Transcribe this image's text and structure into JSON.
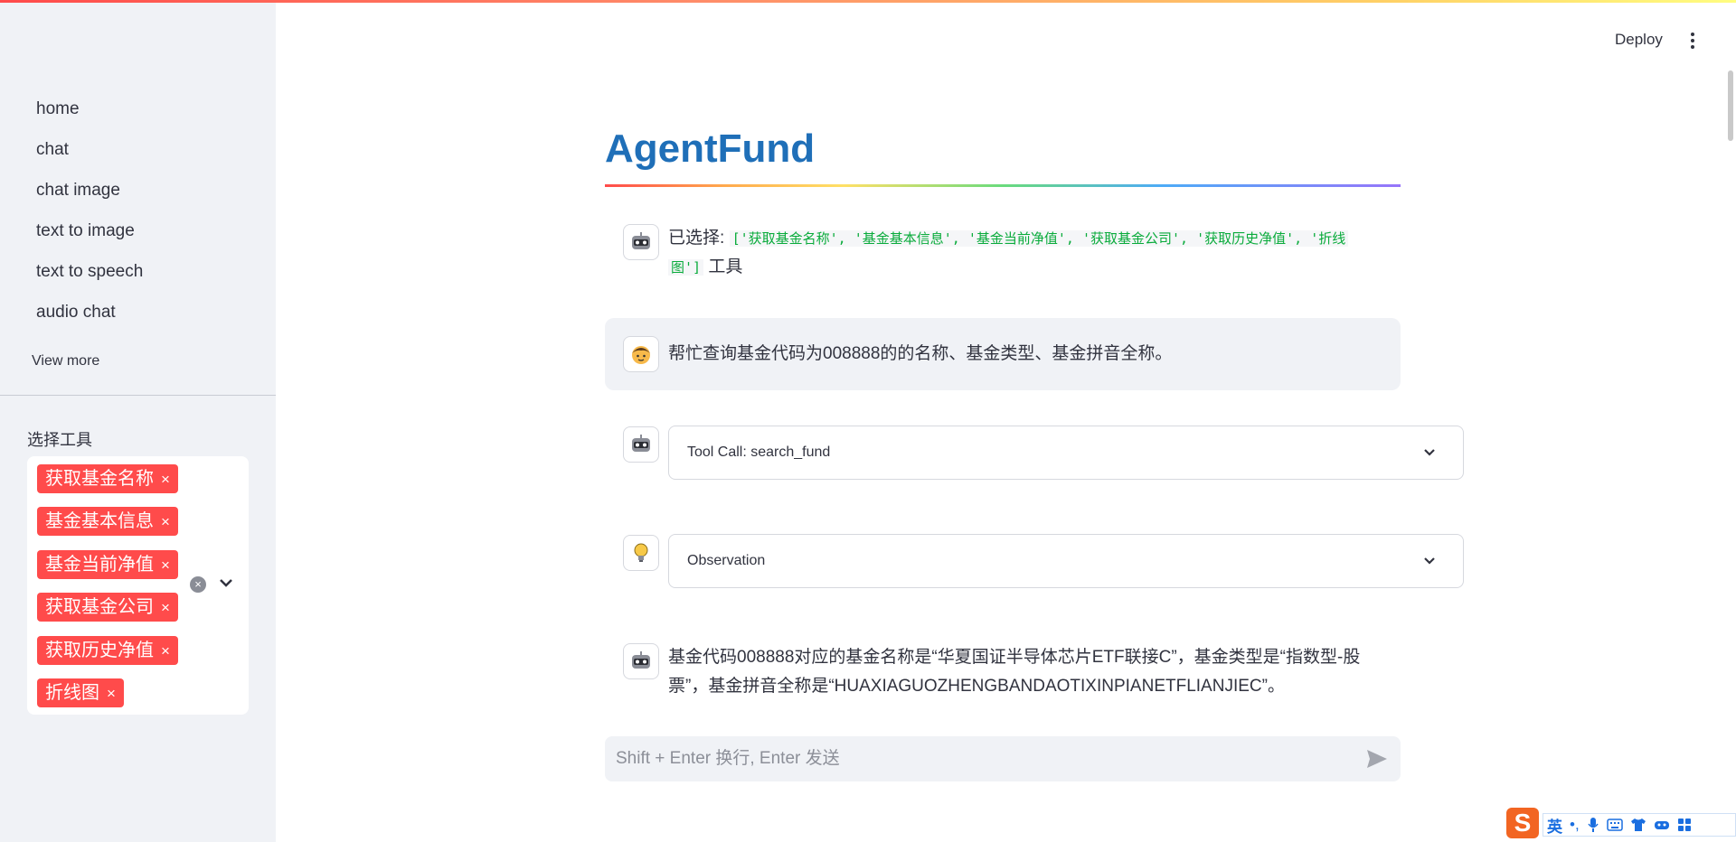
{
  "app": {
    "title": "AgentFund"
  },
  "header": {
    "deploy_label": "Deploy"
  },
  "sidebar": {
    "nav": [
      {
        "label": "home"
      },
      {
        "label": "chat"
      },
      {
        "label": "chat image"
      },
      {
        "label": "text to image"
      },
      {
        "label": "text to speech"
      },
      {
        "label": "audio chat"
      }
    ],
    "view_more": "View more",
    "tools_label": "选择工具",
    "selected_tools": [
      "获取基金名称",
      "基金基本信息",
      "基金当前净值",
      "获取基金公司",
      "获取历史净值",
      "折线图"
    ],
    "remove_glyph": "×"
  },
  "chat": {
    "system_msg": {
      "prefix": "已选择:",
      "tools_code_line1": "['获取基金名称', '基金基本信息', '基金当前净值', '获取基金公司', '获取历史净值', '折线",
      "tools_code_line2": "图']",
      "suffix": "工具"
    },
    "user_msg": "帮忙查询基金代码为008888的的名称、基金类型、基金拼音全称。",
    "tool_call_label": "Tool Call: search_fund",
    "observation_label": "Observation",
    "answer_line1": "基金代码008888对应的基金名称是“华夏国证半导体芯片ETF联接C”，基金类型是“指数型-股",
    "answer_line2": "票”，基金拼音全称是“HUAXIAGUOZHENGBANDAOTIXINPIANETFLIANJIEC”。",
    "input_placeholder": "Shift + Enter 换行, Enter 发送"
  },
  "ime": {
    "logo": "S",
    "mode": "英",
    "punct": "•,"
  },
  "colors": {
    "accent": "#ff4b4b",
    "title": "#1f6fb8",
    "code": "#09ab3b"
  }
}
